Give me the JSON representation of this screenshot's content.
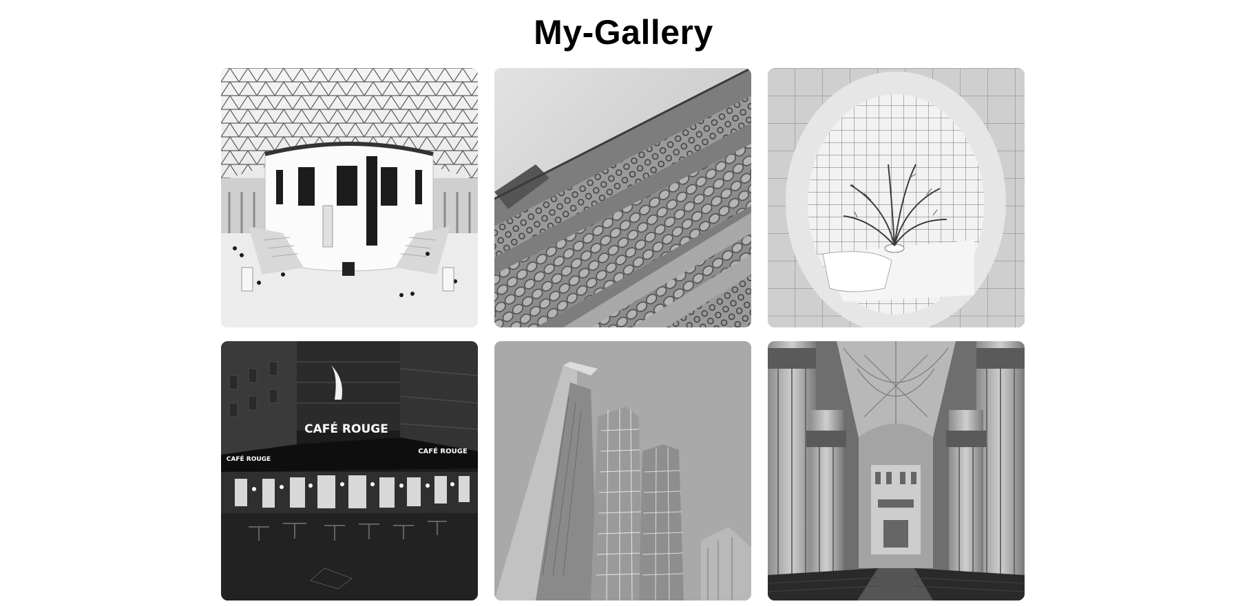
{
  "gallery": {
    "title": "My-Gallery",
    "photos": [
      {
        "name": "museum-court"
      },
      {
        "name": "ornate-facade"
      },
      {
        "name": "tiled-room-plant"
      },
      {
        "name": "cafe-rouge-night",
        "sign_main": "CAFÉ ROUGE",
        "sign_left": "CAFÉ ROUGE",
        "sign_right": "CAFÉ ROUGE"
      },
      {
        "name": "glass-tower"
      },
      {
        "name": "cathedral-nave"
      }
    ]
  }
}
